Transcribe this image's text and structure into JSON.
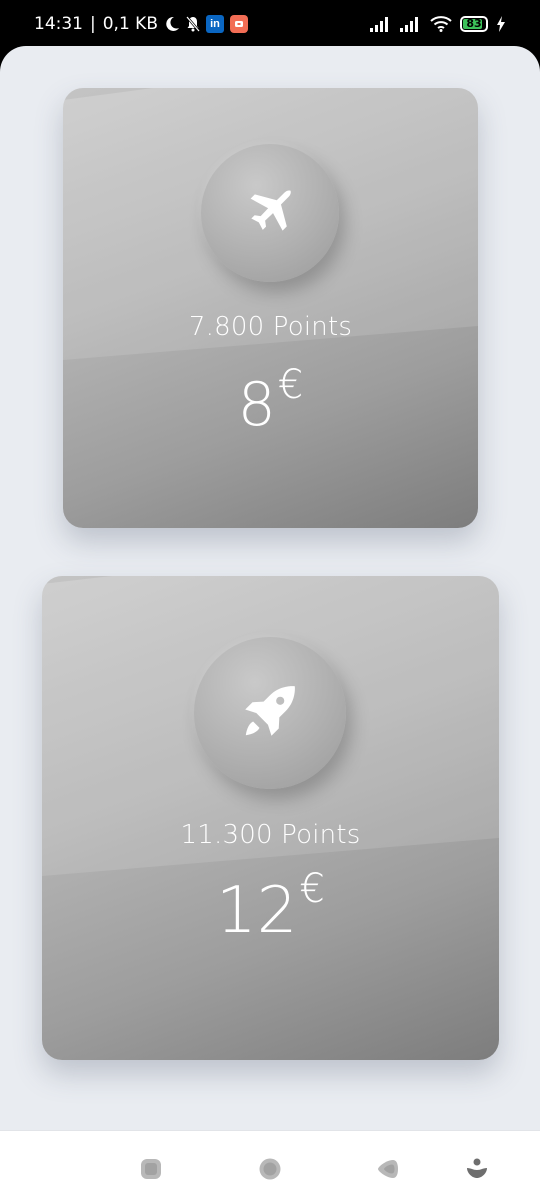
{
  "status_bar": {
    "time": "14:31",
    "separator": "|",
    "network_speed": "0,1 KB",
    "linkedin_label": "in",
    "battery_level": "83",
    "icons": [
      "moon-icon",
      "bell-muted-icon",
      "linkedin-icon",
      "app-notification-icon",
      "signal-icon",
      "signal-icon",
      "wifi-icon",
      "battery-icon",
      "charging-icon"
    ]
  },
  "rewards": [
    {
      "icon": "airplane-icon",
      "points_label": "7.800 Points",
      "price_amount": "8",
      "price_currency": "€"
    },
    {
      "icon": "rocket-icon",
      "points_label": "11.300 Points",
      "price_amount": "12",
      "price_currency": "€"
    }
  ],
  "nav_bar": {
    "icons": [
      "recent-apps-icon",
      "home-icon",
      "back-icon",
      "assistant-icon"
    ]
  },
  "colors": {
    "background": "#e9ecf1",
    "card_light": "#c9c9c9",
    "card_dark": "#7d7d7d",
    "text": "#ffffff"
  }
}
